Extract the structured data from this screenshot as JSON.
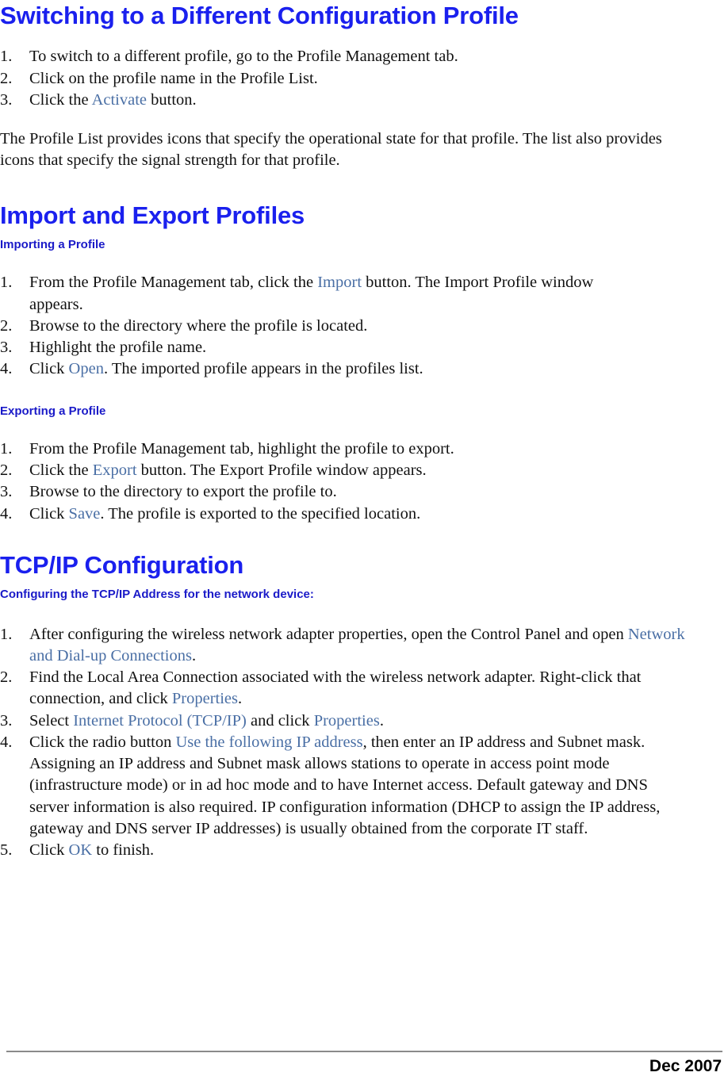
{
  "document": {
    "footer_date": "Dec 2007",
    "colors": {
      "heading_blue": "#1a20ee",
      "subheading_blue": "#1a1ac8",
      "ui_reference_blue": "#4a6fa5",
      "body_black": "#111111",
      "footer_rule_gray": "#8a8a8a"
    }
  },
  "section_switching": {
    "title": "Switching to a Different Configuration Profile",
    "steps": [
      {
        "num": "1.",
        "pre": "To switch to a different profile, go to the Profile Management tab.",
        "ref": "",
        "post": ""
      },
      {
        "num": "2.",
        "pre": "Click on the profile name in the Profile List.",
        "ref": "",
        "post": ""
      },
      {
        "num": "3.",
        "pre": "Click the ",
        "ref": "Activate",
        "post": " button."
      }
    ],
    "paragraph": "The Profile List provides icons that specify the operational state for that profile. The list also provides icons that specify the signal strength for that profile."
  },
  "section_import_export": {
    "title": "Import and Export Profiles",
    "importing": {
      "subtitle": "Importing a Profile",
      "steps": [
        {
          "num": "1.",
          "pre": "From the Profile Management tab, click the ",
          "ref": "Import",
          "post": " button. The Import Profile window appears."
        },
        {
          "num": "2.",
          "pre": "Browse to the directory where the profile is located.",
          "ref": "",
          "post": ""
        },
        {
          "num": "3.",
          "pre": "Highlight the profile name.",
          "ref": "",
          "post": ""
        },
        {
          "num": "4.",
          "pre": "Click ",
          "ref": "Open",
          "post": ". The imported profile appears in the profiles list."
        }
      ]
    },
    "exporting": {
      "subtitle": "Exporting a Profile",
      "steps": [
        {
          "num": "1.",
          "pre": "From the Profile Management tab, highlight the profile to export.",
          "ref": "",
          "post": ""
        },
        {
          "num": "2.",
          "pre": "Click the ",
          "ref": "Export",
          "post": " button. The Export Profile window appears."
        },
        {
          "num": "3.",
          "pre": "Browse to the directory to export the profile to.",
          "ref": "",
          "post": ""
        },
        {
          "num": "4.",
          "pre": "Click ",
          "ref": "Save",
          "post": ". The profile is exported to the specified location."
        }
      ]
    }
  },
  "section_tcpip": {
    "title": "TCP/IP Configuration",
    "subtitle": "Configuring the TCP/IP Address for the network device:",
    "steps": [
      {
        "num": "1.",
        "pre": "After configuring the wireless network adapter properties, open the Control Panel and open ",
        "ref": "Network and Dial-up Connections",
        "post": "."
      },
      {
        "num": "2.",
        "pre": "Find the Local Area Connection associated with the wireless network adapter. Right-click that connection, and click ",
        "ref": "Properties",
        "post": "."
      },
      {
        "num": "3.",
        "pre": "Select ",
        "ref": "Internet Protocol (TCP/IP)",
        "post": " and click ",
        "ref2": "Properties",
        "post2": "."
      },
      {
        "num": "4.",
        "pre": "Click the radio button ",
        "ref": "Use the following IP address",
        "post": ", then enter an IP address and Subnet mask. Assigning an IP address and Subnet mask allows stations to operate in access point mode (infrastructure mode) or in ad hoc mode and to have Internet access. Default gateway and DNS server information is also required.  IP configuration information (DHCP to assign the IP address, gateway and DNS server IP addresses) is usually obtained from the corporate IT staff."
      },
      {
        "num": "5.",
        "pre": "Click ",
        "ref": "OK",
        "post": " to finish."
      }
    ]
  }
}
